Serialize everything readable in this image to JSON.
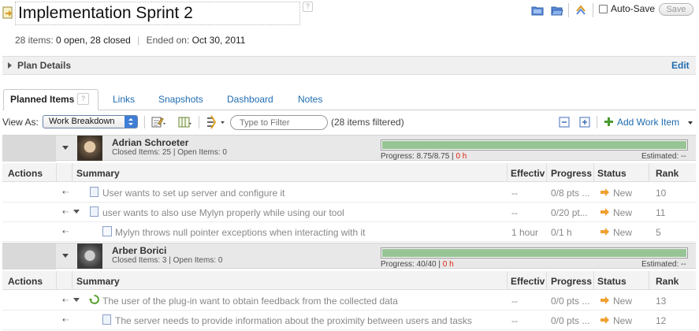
{
  "header": {
    "title": "Implementation Sprint 2",
    "help": "?",
    "autosave_label": "Auto-Save",
    "save_label": "Save",
    "summary": {
      "items_label": "28 items:",
      "counts": "0 open, 28 closed",
      "ended_label": "Ended on:",
      "ended_date": "Oct 30, 2011"
    },
    "plan_details_label": "Plan Details",
    "edit_label": "Edit"
  },
  "tabs": [
    {
      "label": "Planned Items"
    },
    {
      "label": "Links"
    },
    {
      "label": "Snapshots"
    },
    {
      "label": "Dashboard"
    },
    {
      "label": "Notes"
    }
  ],
  "toolbar": {
    "view_as_label": "View As:",
    "view_value": "Work Breakdown",
    "filter_placeholder": "Type to Filter",
    "filter_count": "(28 items filtered)",
    "add_work_item": "Add Work Item"
  },
  "columns": {
    "actions": "Actions",
    "summary": "Summary",
    "effective": "Effectiv",
    "progress": "Progress",
    "status": "Status",
    "rank": "Rank"
  },
  "groups": [
    {
      "name": "Adrian Schroeter",
      "counts": "Closed Items: 25 | Open Items: 0",
      "progress_text": "Progress: 8.75/8.75 | ",
      "progress_red": "0 h",
      "progress_fraction": 1.0,
      "estimated": "Estimated: --",
      "items": [
        {
          "summary": "User wants to set up server and configure it",
          "effective": "--",
          "progress": "0/8 pts ...",
          "status": "New",
          "rank": "10",
          "kind": "story",
          "expandable": false,
          "indent": 0
        },
        {
          "summary": "user wants to also use Mylyn properly while using our tool",
          "effective": "--",
          "progress": "0/20 pt...",
          "status": "New",
          "rank": "11",
          "kind": "story",
          "expandable": true,
          "indent": 0
        },
        {
          "summary": "Mylyn throws null pointer exceptions when interacting with it",
          "effective": "1 hour",
          "progress": "0/1 h",
          "status": "New",
          "rank": "5",
          "kind": "task",
          "expandable": false,
          "indent": 1
        }
      ]
    },
    {
      "name": "Arber Borici",
      "counts": "Closed Items: 3 | Open Items: 0",
      "progress_text": "Progress: 40/40 | ",
      "progress_red": "0 h",
      "progress_fraction": 1.0,
      "estimated": "Estimated: --",
      "items": [
        {
          "summary": "The user of the plug-in want to obtain feedback from the collected data",
          "effective": "--",
          "progress": "0/0 pts ...",
          "status": "New",
          "rank": "13",
          "kind": "epic",
          "expandable": true,
          "indent": 0
        },
        {
          "summary": "The server needs to provide information about the proximity between users and tasks",
          "effective": "--",
          "progress": "0/0 pts ...",
          "status": "New",
          "rank": "12",
          "kind": "story",
          "expandable": false,
          "indent": 1
        }
      ]
    }
  ],
  "colors": {
    "link": "#1f6cb0",
    "progress_fill": "#97c494",
    "status_arrow": "#f0a030",
    "accent_blue": "#3f7ed6"
  }
}
